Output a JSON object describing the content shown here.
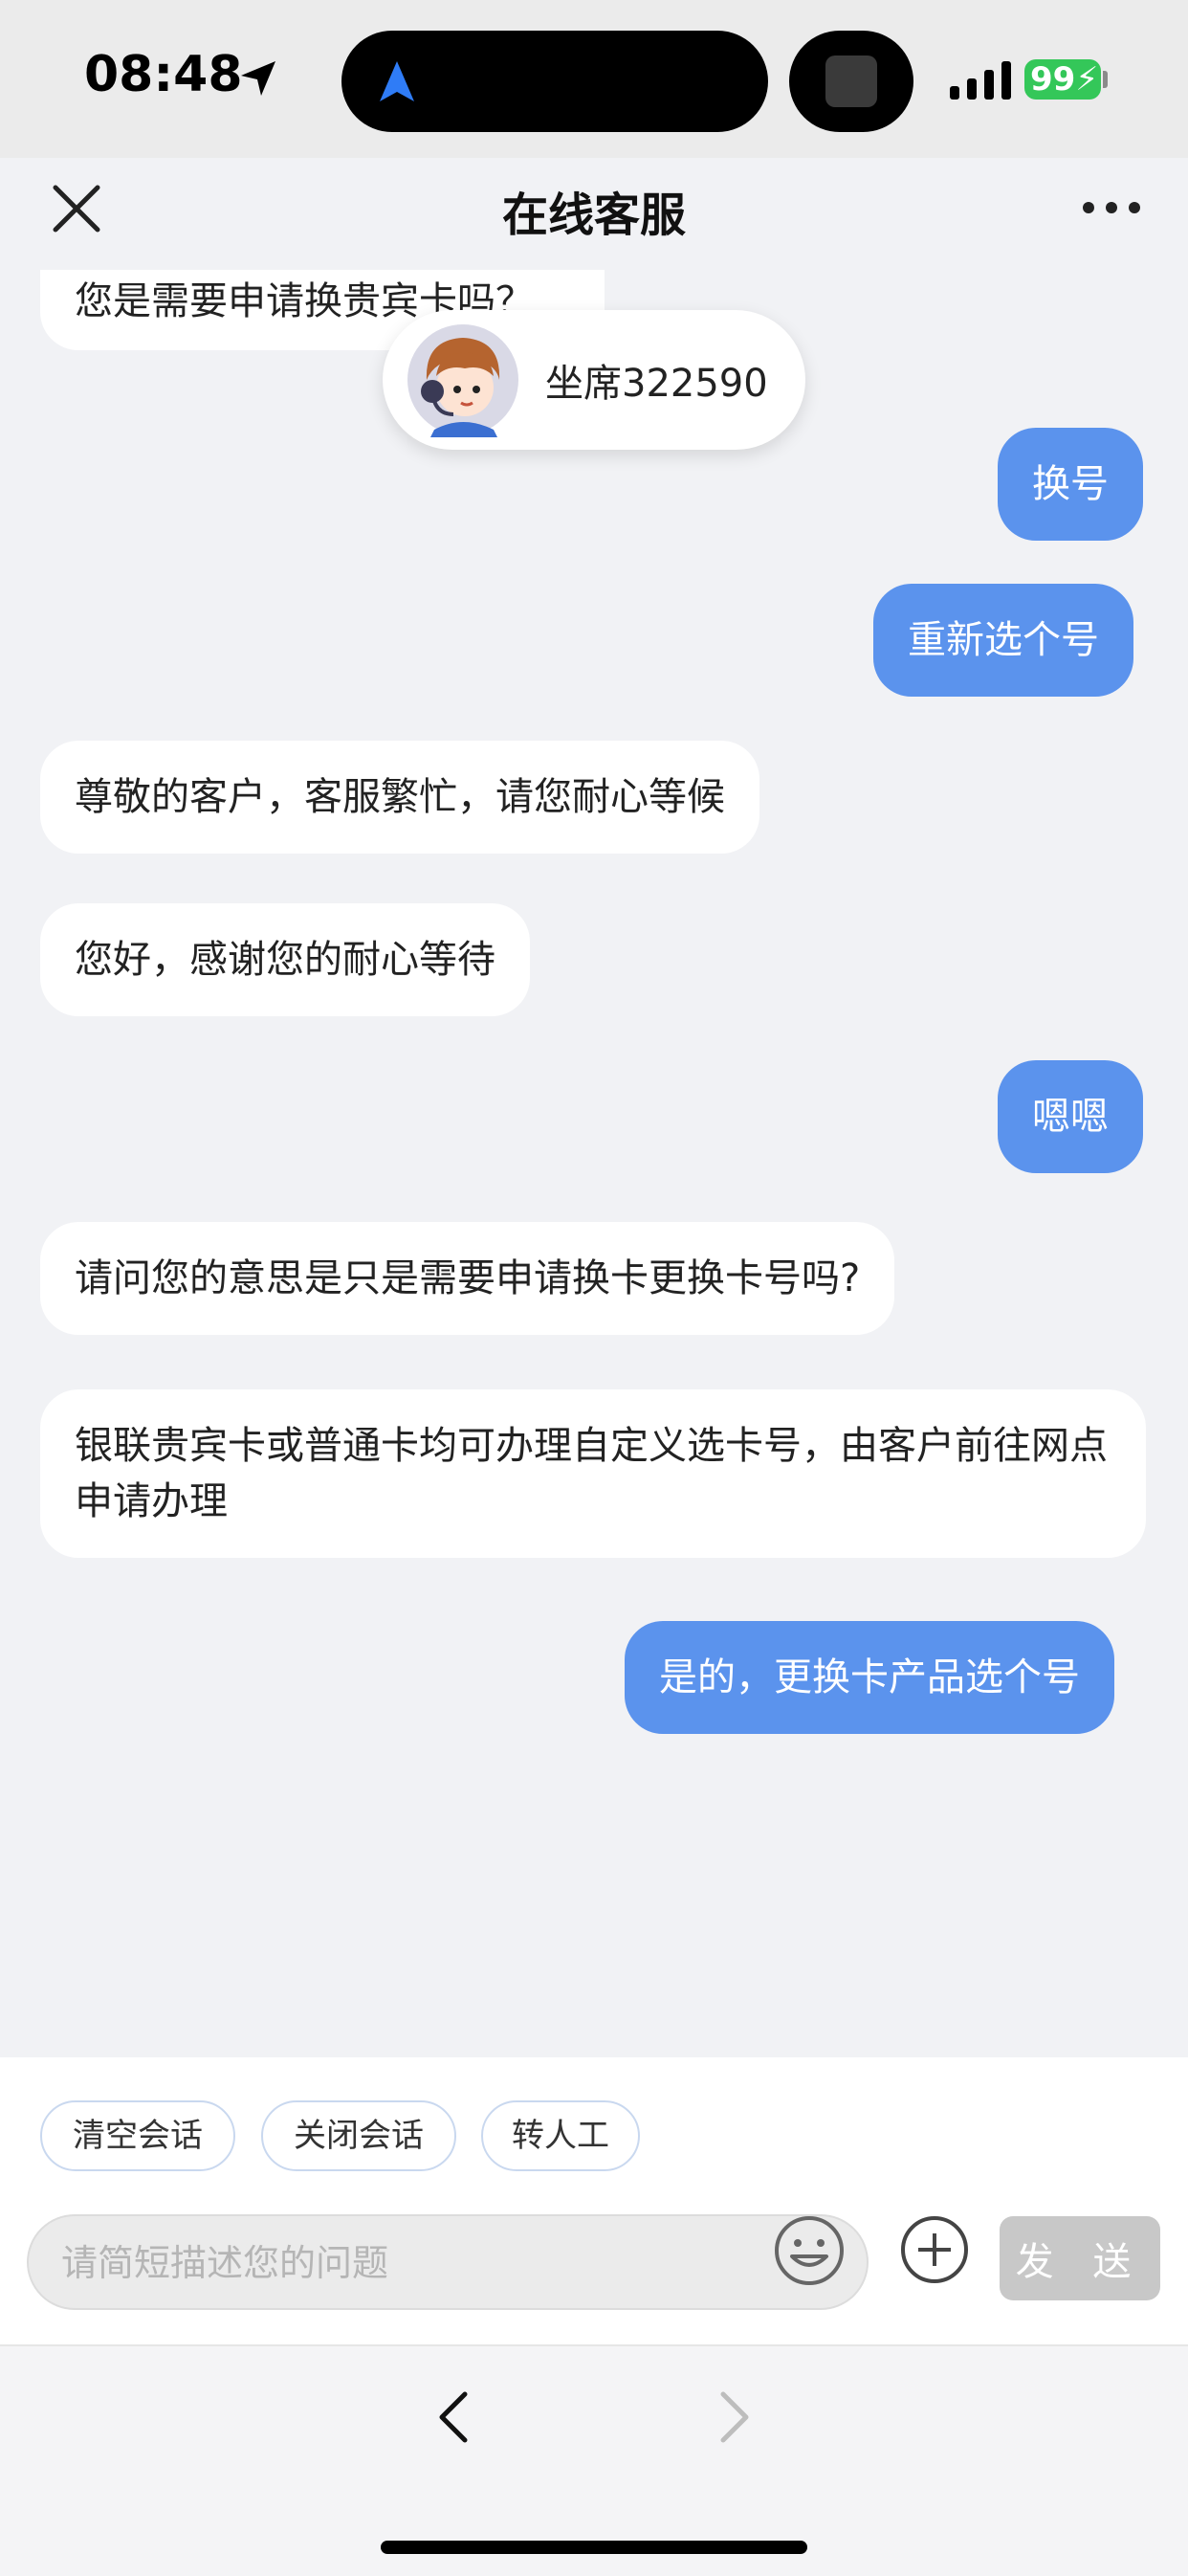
{
  "status_bar": {
    "time": "08:48",
    "battery": "99"
  },
  "header": {
    "title": "在线客服"
  },
  "agent": {
    "name": "坐席322590"
  },
  "messages": [
    {
      "side": "in",
      "text": "您是需要申请换贵宾卡吗？"
    },
    {
      "side": "out",
      "text": "换号"
    },
    {
      "side": "out",
      "text": "重新选个号"
    },
    {
      "side": "in",
      "text": "尊敬的客户，客服繁忙，请您耐心等候"
    },
    {
      "side": "in",
      "text": "您好，感谢您的耐心等待"
    },
    {
      "side": "out",
      "text": "嗯嗯"
    },
    {
      "side": "in",
      "text": "请问您的意思是只是需要申请换卡更换卡号吗?"
    },
    {
      "side": "in",
      "text": "银联贵宾卡或普通卡均可办理自定义选卡号，由客户前往网点申请办理"
    },
    {
      "side": "out",
      "text": "是的，更换卡产品选个号"
    }
  ],
  "quick_actions": [
    "清空会话",
    "关闭会话",
    "转人工"
  ],
  "composer": {
    "placeholder": "请简短描述您的问题",
    "send_label": "发 送"
  },
  "colors": {
    "outgoing_bubble": "#5b93ed",
    "incoming_bubble": "#ffffff",
    "send_disabled": "#c8c8c8",
    "battery": "#34c759"
  },
  "icons": [
    "location-arrow-icon",
    "navigation-icon",
    "signal-icon",
    "close-icon",
    "more-icon",
    "emoji-icon",
    "plus-icon",
    "back-icon",
    "forward-icon"
  ]
}
